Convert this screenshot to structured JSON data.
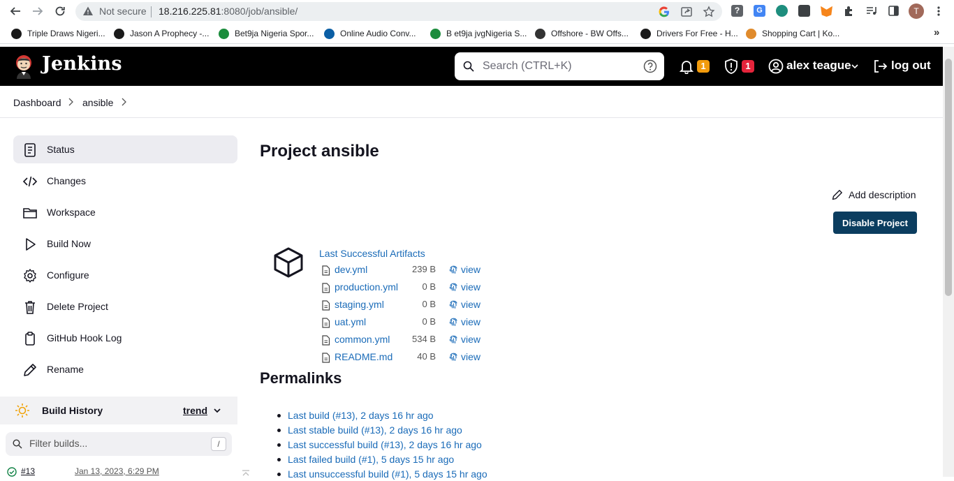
{
  "browser": {
    "security_label": "Not secure",
    "url_host": "18.216.225.81",
    "url_rest": ":8080/job/ansible/",
    "profile_initial": "T",
    "bookmarks": [
      {
        "label": "Triple Draws Nigeri...",
        "icon": "globe-icon",
        "color": "#1a1a1a"
      },
      {
        "label": "Jason A Prophecy -...",
        "icon": "globe-icon",
        "color": "#1a1a1a"
      },
      {
        "label": "Bet9ja Nigeria Spor...",
        "icon": "bet9ja-icon",
        "color": "#1b8c3c"
      },
      {
        "label": "Online Audio Conv...",
        "icon": "audio-converter-icon",
        "color": "#0b5fa5"
      },
      {
        "label": "B et9ja jvgNigeria S...",
        "icon": "bet9ja-icon",
        "color": "#1b8c3c"
      },
      {
        "label": "Offshore - BW Offs...",
        "icon": "offshore-icon",
        "color": "#333"
      },
      {
        "label": "Drivers For Free - H...",
        "icon": "globe-icon",
        "color": "#1a1a1a"
      },
      {
        "label": "Shopping Cart | Ko...",
        "icon": "basketball-icon",
        "color": "#e08b2c"
      }
    ],
    "more_bookmarks": "»"
  },
  "header": {
    "app_name": "Jenkins",
    "search_placeholder": "Search (CTRL+K)",
    "notifications_count": "1",
    "security_count": "1",
    "user_name": "alex teague",
    "logout_label": "log out",
    "colors": {
      "notify_badge": "#f29b0c",
      "security_badge": "#e5243b"
    }
  },
  "breadcrumb": {
    "items": [
      "Dashboard",
      "ansible"
    ]
  },
  "sidebar": {
    "items": [
      {
        "label": "Status",
        "icon": "status-icon"
      },
      {
        "label": "Changes",
        "icon": "code-icon"
      },
      {
        "label": "Workspace",
        "icon": "folder-icon"
      },
      {
        "label": "Build Now",
        "icon": "play-icon"
      },
      {
        "label": "Configure",
        "icon": "gear-icon"
      },
      {
        "label": "Delete Project",
        "icon": "trash-icon"
      },
      {
        "label": "GitHub Hook Log",
        "icon": "clipboard-icon"
      },
      {
        "label": "Rename",
        "icon": "pencil-icon"
      }
    ],
    "build_history": {
      "title": "Build History",
      "trend_label": "trend",
      "filter_placeholder": "Filter builds...",
      "filter_shortcut": "/",
      "rows": [
        {
          "build": "#13",
          "date": "Jan 13, 2023, 6:29 PM"
        }
      ]
    }
  },
  "main": {
    "title": "Project ansible",
    "add_description": "Add description",
    "disable_button": "Disable Project",
    "artifacts": {
      "title": "Last Successful Artifacts",
      "view_label": "view",
      "files": [
        {
          "name": "dev.yml",
          "size": "239 B"
        },
        {
          "name": "production.yml",
          "size": "0 B"
        },
        {
          "name": "staging.yml",
          "size": "0 B"
        },
        {
          "name": "uat.yml",
          "size": "0 B"
        },
        {
          "name": "common.yml",
          "size": "534 B"
        },
        {
          "name": "README.md",
          "size": "40 B"
        }
      ]
    },
    "permalinks": {
      "title": "Permalinks",
      "items": [
        "Last build (#13), 2 days 16 hr ago",
        "Last stable build (#13), 2 days 16 hr ago",
        "Last successful build (#13), 2 days 16 hr ago",
        "Last failed build (#1), 5 days 15 hr ago",
        "Last unsuccessful build (#1), 5 days 15 hr ago"
      ]
    }
  }
}
